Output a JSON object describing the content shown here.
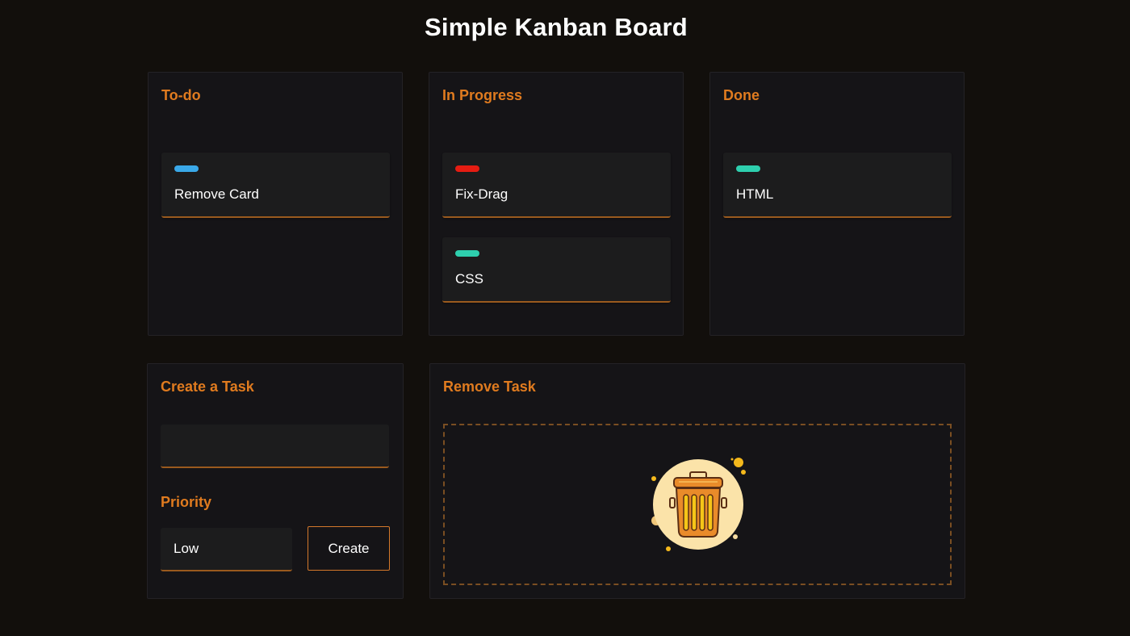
{
  "page": {
    "title": "Simple Kanban Board"
  },
  "columns": [
    {
      "title": "To-do",
      "cards": [
        {
          "label": "Remove Card",
          "tag_color": "#3aa8e8"
        }
      ]
    },
    {
      "title": "In Progress",
      "cards": [
        {
          "label": "Fix-Drag",
          "tag_color": "#e51c12"
        },
        {
          "label": "CSS",
          "tag_color": "#2ecfae"
        }
      ]
    },
    {
      "title": "Done",
      "cards": [
        {
          "label": "HTML",
          "tag_color": "#2ecfae"
        }
      ]
    }
  ],
  "create_task": {
    "title": "Create a Task",
    "input_value": "",
    "priority_label": "Priority",
    "priority_value": "Low",
    "create_label": "Create"
  },
  "remove_task": {
    "title": "Remove Task",
    "icon": "trash-can-icon"
  },
  "colors": {
    "accent": "#e07b1f",
    "background": "#120f0c",
    "panel": "#151417",
    "card": "#1c1c1d"
  }
}
